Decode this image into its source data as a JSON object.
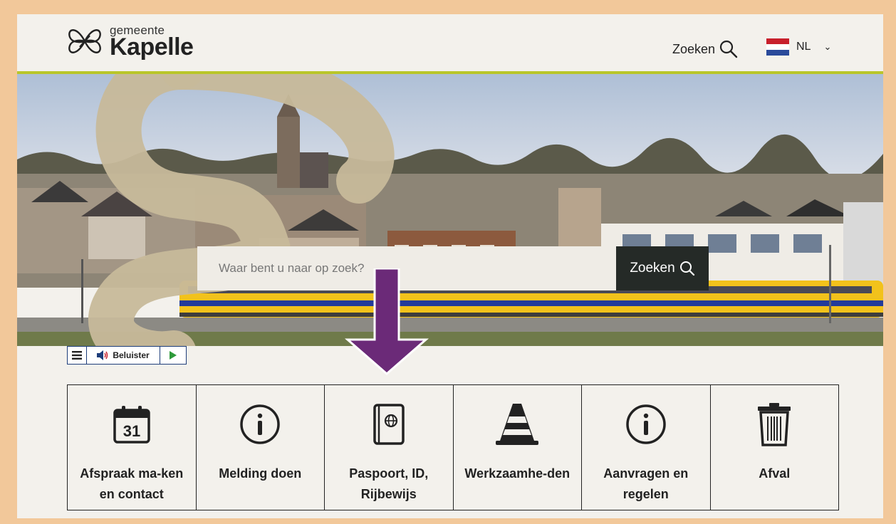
{
  "header": {
    "logo_small": "gemeente",
    "logo_big": "Kapelle",
    "search_label": "Zoeken",
    "language": "NL"
  },
  "hero": {
    "search_placeholder": "Waar bent u naar op zoek?",
    "search_button": "Zoeken"
  },
  "listen_bar": {
    "label": "Beluister"
  },
  "tiles": [
    {
      "label": "Afspraak ma-ken en contact",
      "icon": "calendar-icon",
      "icon_text": "31"
    },
    {
      "label": "Melding doen",
      "icon": "info-icon"
    },
    {
      "label": "Paspoort, ID, Rijbewijs",
      "icon": "passport-icon"
    },
    {
      "label": "Werkzaamhe-den",
      "icon": "traffic-cone-icon"
    },
    {
      "label": "Aanvragen en regelen",
      "icon": "info-icon"
    },
    {
      "label": "Afval",
      "icon": "trash-bin-icon"
    }
  ],
  "colors": {
    "accent_line": "#b9c62a",
    "search_button_bg": "#252a27",
    "annotation_arrow": "#6b2a78",
    "outer_border": "#f2c89a"
  }
}
